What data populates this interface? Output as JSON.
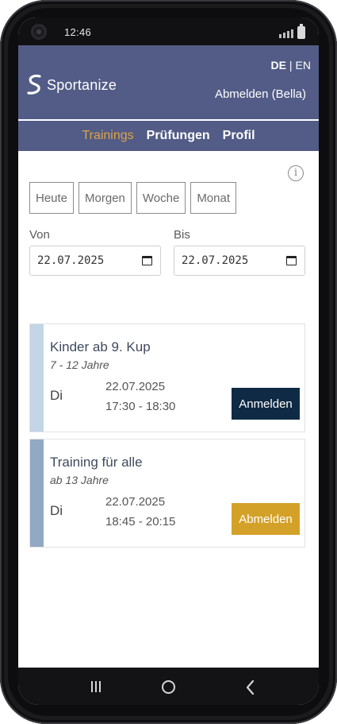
{
  "status": {
    "time": "12:46"
  },
  "header": {
    "brand": "Sportanize",
    "lang_active": "DE",
    "lang_separator": "|",
    "lang_other": "EN",
    "logout": "Abmelden (Bella)"
  },
  "nav": {
    "tabs": [
      "Trainings",
      "Prüfungen",
      "Profil"
    ],
    "active": "Trainings"
  },
  "filters": {
    "quick": [
      "Heute",
      "Morgen",
      "Woche",
      "Monat"
    ],
    "from_label": "Von",
    "from_value": "22.07.2025",
    "to_label": "Bis",
    "to_value": "22.07.2025"
  },
  "trainings": [
    {
      "title": "Kinder ab 9. Kup",
      "age": "7 - 12 Jahre",
      "day": "Di",
      "date": "22.07.2025",
      "hours": "17:30 - 18:30",
      "action": "Anmelden",
      "stripe_color": "#c3d5e7",
      "button_color": "#0f2a44"
    },
    {
      "title": "Training für alle",
      "age": "ab 13 Jahre",
      "day": "Di",
      "date": "22.07.2025",
      "hours": "18:45 - 20:15",
      "action": "Abmelden",
      "stripe_color": "#91a9c3",
      "button_color": "#d4a128"
    }
  ],
  "colors": {
    "header_bg": "#525c86",
    "active_tab": "#e0a341"
  },
  "icons": [
    "camera-icon",
    "signal-icon",
    "battery-icon",
    "brand-logo-icon",
    "info-icon",
    "calendar-icon",
    "recents-icon",
    "home-icon",
    "back-icon"
  ]
}
